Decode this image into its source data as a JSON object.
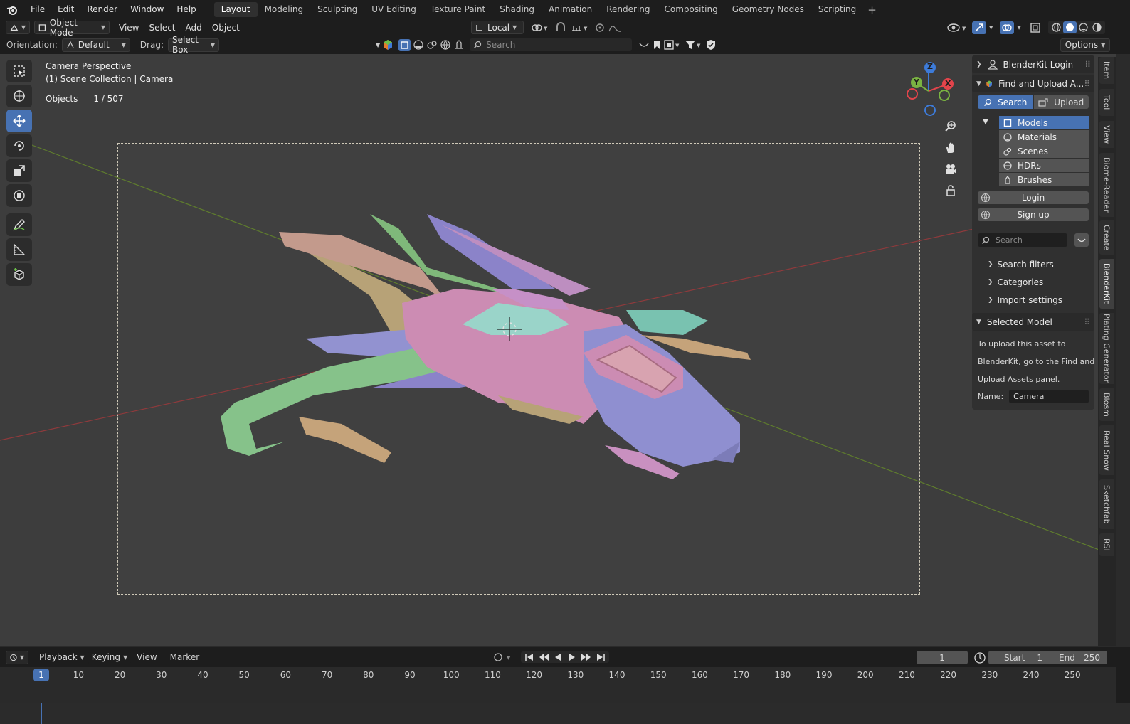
{
  "menubar": {
    "items": [
      "File",
      "Edit",
      "Render",
      "Window",
      "Help"
    ],
    "workspaces": [
      "Layout",
      "Modeling",
      "Sculpting",
      "UV Editing",
      "Texture Paint",
      "Shading",
      "Animation",
      "Rendering",
      "Compositing",
      "Geometry Nodes",
      "Scripting"
    ],
    "add_tab": "+"
  },
  "header": {
    "mode": "Object Mode",
    "menus": [
      "View",
      "Select",
      "Add",
      "Object"
    ],
    "pivot": "Local"
  },
  "toolheader": {
    "orientation_label": "Orientation:",
    "orientation_value": "Default",
    "drag_label": "Drag:",
    "drag_value": "Select Box",
    "search_placeholder": "Search",
    "options": "Options"
  },
  "viewport": {
    "view_name": "Camera Perspective",
    "collection": "(1) Scene Collection | Camera",
    "objects_label": "Objects",
    "objects_count": "1 / 507",
    "axes": [
      "X",
      "Y",
      "Z"
    ]
  },
  "colors": {
    "accent": "#4772b3",
    "axis_x": "#e2444b",
    "axis_y": "#7ab342",
    "axis_z": "#3d7bd9"
  },
  "blenderkit": {
    "login_panel": "BlenderKit Login",
    "find_panel": "Find and Upload A...",
    "search_tab": "Search",
    "upload_tab": "Upload",
    "categories": [
      "Models",
      "Materials",
      "Scenes",
      "HDRs",
      "Brushes"
    ],
    "login_button": "Login",
    "signup_button": "Sign up",
    "search_placeholder": "Search",
    "search_filters": "Search filters",
    "categories_label": "Categories",
    "import_settings": "Import settings",
    "selected_model_panel": "Selected Model",
    "info_line1": "To upload this asset to",
    "info_line2": "BlenderKit, go to the Find and",
    "info_line3": "Upload Assets panel.",
    "name_label": "Name:",
    "name_value": "Camera"
  },
  "sidebar_tabs": [
    "Item",
    "Tool",
    "View",
    "Biome-Reader",
    "Create",
    "BlenderKit",
    "Plating Generator",
    "Blosm",
    "Real Snow",
    "Sketchfab",
    "RSI"
  ],
  "timeline": {
    "menus": [
      "Playback",
      "Keying",
      "View",
      "Marker"
    ],
    "current_frame": "1",
    "start_label": "Start",
    "start_value": "1",
    "end_label": "End",
    "end_value": "250",
    "ticks": [
      "10",
      "20",
      "30",
      "40",
      "50",
      "60",
      "70",
      "80",
      "90",
      "100",
      "110",
      "120",
      "130",
      "140",
      "150",
      "160",
      "170",
      "180",
      "190",
      "200",
      "210",
      "220",
      "230",
      "240",
      "250"
    ],
    "playhead": "1"
  }
}
